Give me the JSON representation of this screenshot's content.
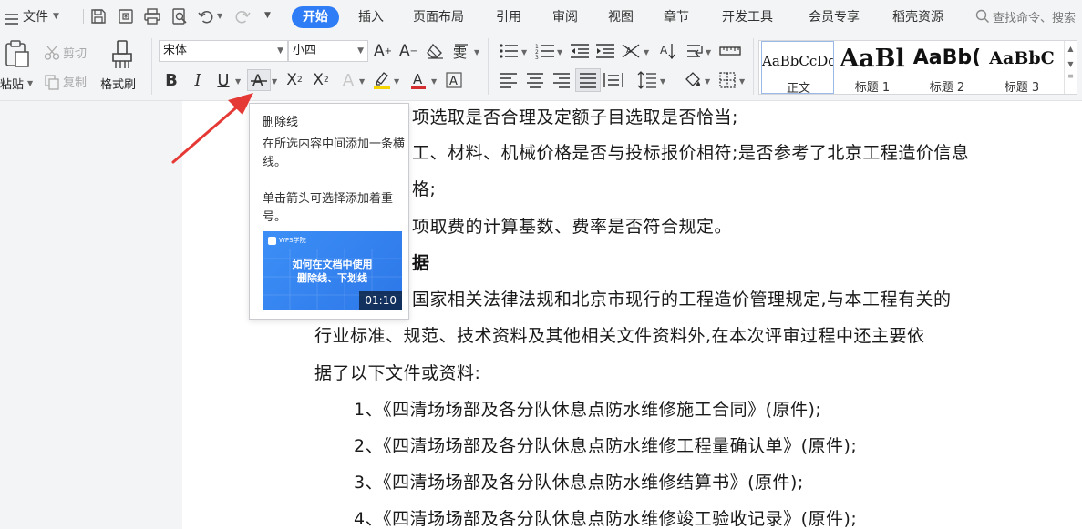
{
  "menubar": {
    "file_menu": "文件",
    "tabs": [
      {
        "label": "开始",
        "active": true
      },
      {
        "label": "插入"
      },
      {
        "label": "页面布局"
      },
      {
        "label": "引用"
      },
      {
        "label": "审阅"
      },
      {
        "label": "视图"
      },
      {
        "label": "章节"
      },
      {
        "label": "开发工具"
      },
      {
        "label": "会员专享"
      },
      {
        "label": "稻壳资源"
      }
    ],
    "search_text": "查找命令、搜索"
  },
  "ribbon": {
    "paste_label": "粘贴",
    "cut_label": "剪切",
    "copy_label": "复制",
    "format_painter_label": "格式刷",
    "font_name": "宋体",
    "font_size": "小四",
    "styles": [
      {
        "preview": "AaBbCcDd",
        "label": "正文",
        "selected": true
      },
      {
        "preview": "AaBl",
        "label": "标题 1"
      },
      {
        "preview": "AaBb(",
        "label": "标题 2"
      },
      {
        "preview": "AaBbC",
        "label": "标题 3"
      }
    ]
  },
  "tooltip": {
    "title": "删除线",
    "description": "在所选内容中间添加一条横线。",
    "hint": "单击箭头可选择添加着重号。",
    "video_brand": "WPS学院",
    "video_title": [
      "如何在文档中使用",
      "删除线、下划线"
    ],
    "video_duration": "01:10"
  },
  "document": {
    "lines": [
      "项选取是否合理及定额子目选取是否恰当;",
      "工、材料、机械价格是否与投标报价相符;是否参考了北京工程造价信息",
      "格;",
      "项取费的计算基数、费率是否符合规定。"
    ],
    "heading": "据",
    "para_first": "国家相关法律法规和北京市现行的工程造价管理规定,与本工程有关的",
    "para_lines": [
      "行业标准、规范、技术资料及其他相关文件资料外,在本次评审过程中还主要依",
      "据了以下文件或资料:"
    ],
    "list": [
      "1、《四清场场部及各分队休息点防水维修施工合同》(原件);",
      "2、《四清场场部及各分队休息点防水维修工程量确认单》(原件);",
      "3、《四清场场部及各分队休息点防水维修结算书》(原件);",
      "4、《四清场场部及各分队休息点防水维修竣工验收记录》(原件);"
    ]
  },
  "colors": {
    "accent": "#2f7df6",
    "highlight": "#f5d400",
    "font_color": "#d32f2f",
    "arrow": "#e53935"
  },
  "icons": [
    "menu-icon",
    "save-icon",
    "export-icon",
    "print-icon",
    "print-preview-icon",
    "undo-icon",
    "redo-icon",
    "search-icon"
  ]
}
